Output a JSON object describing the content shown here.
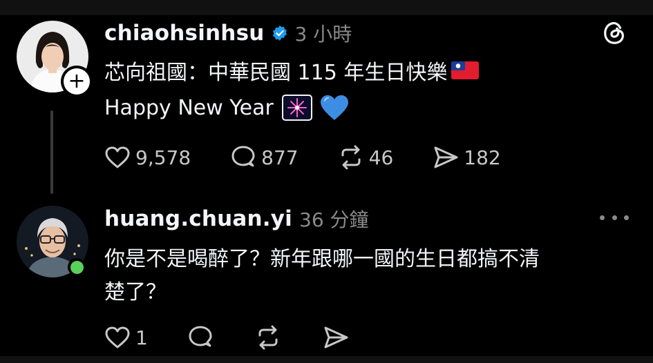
{
  "post": {
    "username": "chiaohsinhsu",
    "timestamp": "3 小時",
    "text_line1": "芯向祖國：中華民國 115 年生日快樂",
    "text_line2": "Happy New Year",
    "emoji": [
      "taiwan-flag",
      "fireworks",
      "blue-heart"
    ],
    "actions": {
      "likes": "9,578",
      "replies": "877",
      "reposts": "46",
      "shares": "182"
    }
  },
  "reply": {
    "username": "huang.chuan.yi",
    "timestamp": "36 分鐘",
    "text_line1": "你是不是喝醉了？新年跟哪一國的生日都搞不清",
    "text_line2": "楚了？",
    "actions": {
      "likes": "1"
    }
  },
  "icons": [
    "verified-badge-icon",
    "threads-logo-icon",
    "plus-icon",
    "more-icon",
    "heart-icon",
    "reply-icon",
    "repost-icon",
    "share-icon"
  ],
  "colors": {
    "background": "#000000",
    "text": "#f3f5f7",
    "muted": "#8a8a8a",
    "verified": "#1d9bf0",
    "online": "#5bd05b"
  }
}
